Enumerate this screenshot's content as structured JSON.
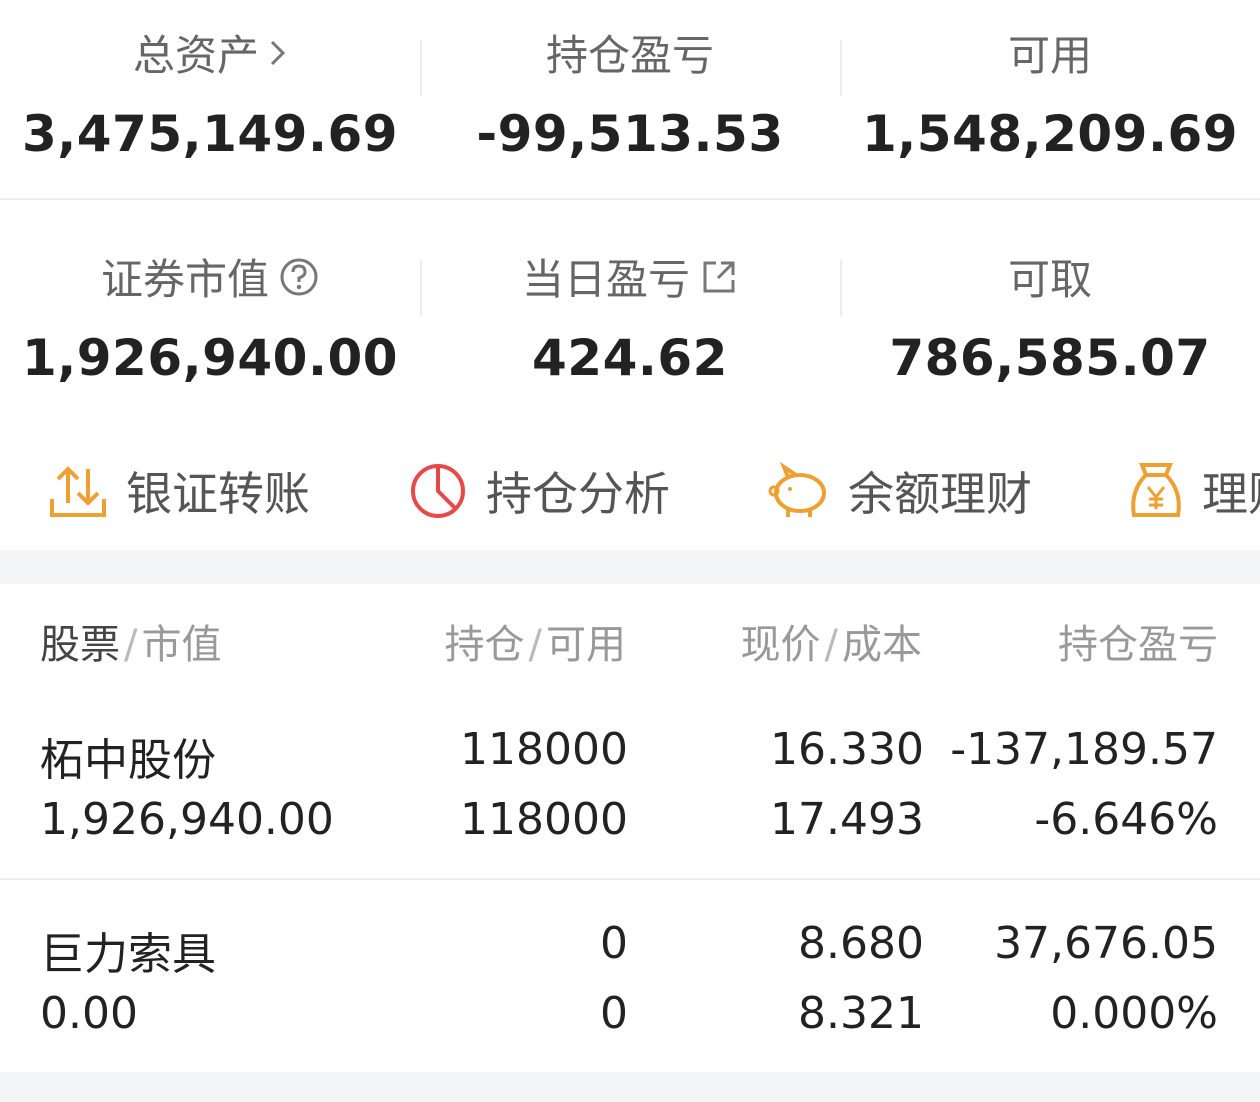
{
  "summary": {
    "total_assets": {
      "label": "总资产",
      "value": "3,475,149.69"
    },
    "position_pl": {
      "label": "持仓盈亏",
      "value": "-99,513.53"
    },
    "available": {
      "label": "可用",
      "value": "1,548,209.69"
    },
    "securities_value": {
      "label": "证券市值",
      "value": "1,926,940.00"
    },
    "daily_pl": {
      "label": "当日盈亏",
      "value": "424.62"
    },
    "withdrawable": {
      "label": "可取",
      "value": "786,585.07"
    }
  },
  "actions": [
    {
      "label": "银证转账",
      "icon": "transfer-icon"
    },
    {
      "label": "持仓分析",
      "icon": "pie-chart-icon"
    },
    {
      "label": "余额理财",
      "icon": "piggy-bank-icon"
    },
    {
      "label": "理财",
      "icon": "money-bag-icon"
    }
  ],
  "table": {
    "headers": {
      "col1": {
        "main": "股票",
        "sub": "市值"
      },
      "col2": {
        "main": "持仓",
        "sub": "可用"
      },
      "col3": {
        "main": "现价",
        "sub": "成本"
      },
      "col4": {
        "main": "持仓盈亏"
      }
    },
    "rows": [
      {
        "name": "柘中股份",
        "market_value": "1,926,940.00",
        "position": "118000",
        "available": "118000",
        "price": "16.330",
        "cost": "17.493",
        "pl": "-137,189.57",
        "pl_pct": "-6.646%",
        "pl_color": "#1da832"
      },
      {
        "name": "巨力索具",
        "market_value": "0.00",
        "position": "0",
        "available": "0",
        "price": "8.680",
        "cost": "8.321",
        "pl": "37,676.05",
        "pl_pct": "0.000%",
        "pl_color": "#e03030"
      }
    ]
  }
}
